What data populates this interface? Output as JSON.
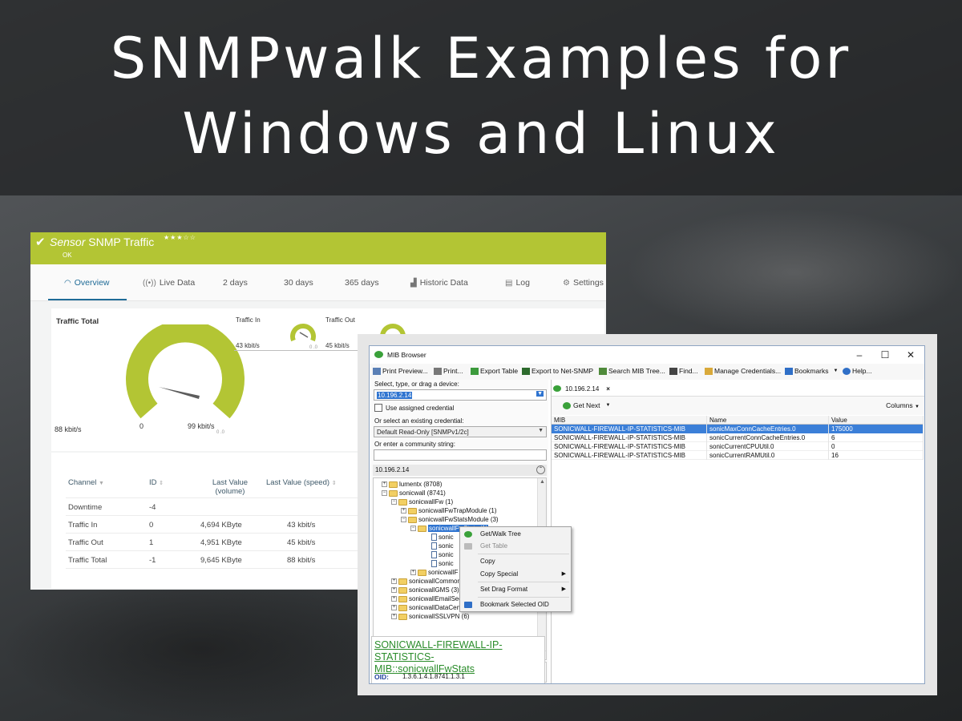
{
  "headline": {
    "line1": "SNMPwalk Examples for",
    "line2": "Windows and Linux"
  },
  "colors": {
    "sensor_accent": "#b3c534",
    "tab_active": "#1f6c98",
    "mib_link": "#2a8c2a",
    "selection": "#2f74d0"
  },
  "sensor": {
    "title_prefix": "Sensor",
    "title": "SNMP Traffic",
    "stars": "★★★☆☆",
    "status": "OK",
    "tabs": [
      {
        "label": "Overview",
        "icon": "gauge-icon"
      },
      {
        "label": "Live Data",
        "icon": "signal-icon"
      },
      {
        "label": "2  days"
      },
      {
        "label": "30 days"
      },
      {
        "label": "365 days"
      },
      {
        "label": "Historic Data",
        "icon": "bar-chart-icon"
      },
      {
        "label": "Log",
        "icon": "list-icon"
      },
      {
        "label": "Settings",
        "icon": "gear-icon"
      }
    ],
    "gauges": {
      "total": {
        "label": "Traffic Total",
        "value": "88 kbit/s",
        "min": "0",
        "max": "99 kbit/s",
        "tiny": "0 .0"
      },
      "in": {
        "label": "Traffic In",
        "value": "43 kbit/s",
        "tiny": "0 .0"
      },
      "out": {
        "label": "Traffic Out",
        "value": "45 kbit/s"
      }
    },
    "table": {
      "headers": [
        "Channel",
        "ID",
        "Last Value (volume)",
        "Last Value (speed)"
      ],
      "rows": [
        {
          "channel": "Downtime",
          "id": "-4",
          "volume": "",
          "speed": ""
        },
        {
          "channel": "Traffic In",
          "id": "0",
          "volume": "4,694 KByte",
          "speed": "43 kbit/s"
        },
        {
          "channel": "Traffic Out",
          "id": "1",
          "volume": "4,951 KByte",
          "speed": "45 kbit/s"
        },
        {
          "channel": "Traffic Total",
          "id": "-1",
          "volume": "9,645 KByte",
          "speed": "88 kbit/s"
        }
      ]
    }
  },
  "mib": {
    "title": "MIB Browser",
    "window_buttons": [
      "–",
      "☐",
      "✕"
    ],
    "toolbar": [
      "Print Preview...",
      "Print...",
      "Export Table",
      "Export to Net-SNMP",
      "Search MIB Tree...",
      "Find...",
      "Manage Credentials...",
      "Bookmarks",
      "Help..."
    ],
    "device_label": "Select, type, or drag a device:",
    "device_value": "10.196.2.14",
    "use_assigned": "Use assigned credential",
    "credential_label": "Or select an existing credential:",
    "credential_value": "Default Read-Only [SNMPv1/2c]",
    "community_label": "Or enter a community string:",
    "community_value": "",
    "device_bar": "10.196.2.14",
    "tree": [
      "lumentx (8708)",
      "sonicwall (8741)",
      "sonicwallFw (1)",
      "sonicwallFwTrapModule (1)",
      "sonicwallFwStatsModule (3)",
      "sonicwallFwStats (1)",
      "sonic",
      "sonic",
      "sonic",
      "sonic",
      "sonicwallF",
      "sonicwallCommon",
      "sonicwallGMS (3)",
      "sonicwallEmailSec",
      "sonicwallDataCen",
      "sonicwallSSLVPN (6)"
    ],
    "description_link": "SONICWALL-FIREWALL-IP-STATISTICS-MIB::sonicwallFwStats",
    "oid_label": "OID:",
    "oid_value": "1.3.6.1.4.1.8741.1.3.1",
    "result_tab": "10.196.2.14",
    "get_next": "Get Next",
    "columns_label": "Columns",
    "grid_headers": [
      "MIB",
      "Name",
      "Value"
    ],
    "grid_rows": [
      {
        "mib": "SONICWALL-FIREWALL-IP-STATISTICS-MIB",
        "name": "sonicMaxConnCacheEntries.0",
        "value": "175000"
      },
      {
        "mib": "SONICWALL-FIREWALL-IP-STATISTICS-MIB",
        "name": "sonicCurrentConnCacheEntries.0",
        "value": "6"
      },
      {
        "mib": "SONICWALL-FIREWALL-IP-STATISTICS-MIB",
        "name": "sonicCurrentCPUUtil.0",
        "value": "0"
      },
      {
        "mib": "SONICWALL-FIREWALL-IP-STATISTICS-MIB",
        "name": "sonicCurrentRAMUtil.0",
        "value": "16"
      }
    ],
    "context_menu": [
      "Get/Walk Tree",
      "Get Table",
      "Copy",
      "Copy Special",
      "Set Drag Format",
      "Bookmark Selected OID"
    ]
  }
}
